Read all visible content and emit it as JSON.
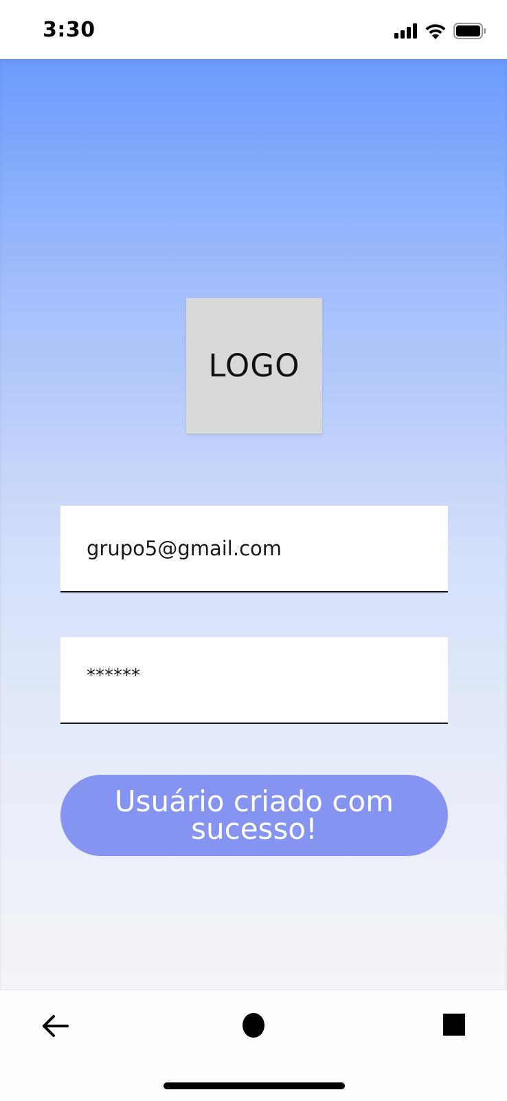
{
  "status_bar": {
    "time": "3:30",
    "icons": [
      "cellular-signal-icon",
      "wifi-icon",
      "battery-icon"
    ]
  },
  "logo": {
    "text": "LOGO"
  },
  "form": {
    "email_value": "grupo5@gmail.com",
    "password_value": "******",
    "button_label": "Usuário criado com sucesso!"
  },
  "nav_bar": {
    "icons": [
      "back-arrow-icon",
      "home-circle-icon",
      "recents-square-icon"
    ]
  },
  "colors": {
    "gradient_top": "#6a9bfd",
    "gradient_bottom": "#f3f4f8",
    "button": "#8494f0",
    "logo_placeholder": "#d9d9d9"
  }
}
